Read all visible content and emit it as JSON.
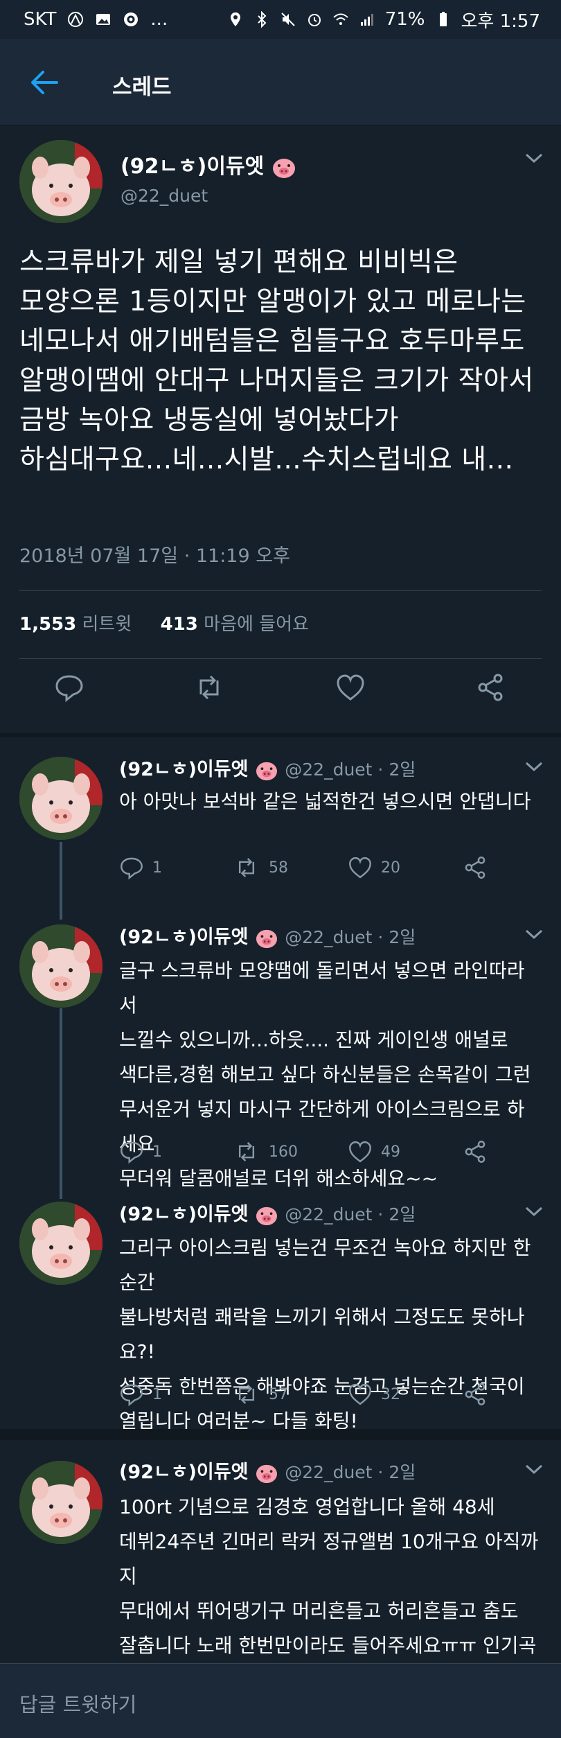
{
  "status_bar": {
    "carrier": "SKT",
    "more": "...",
    "battery": "71%",
    "time": "오후 1:57"
  },
  "header": {
    "title": "스레드"
  },
  "main_tweet": {
    "name": "(92ㄴㅎ)이듀엣",
    "handle": "@22_duet",
    "text": "스크류바가 제일 넣기 편해요 비비빅은\n모양으론 1등이지만 알맹이가 있고 메로나는\n네모나서 애기배텀들은 힘들구요 호두마루도\n알맹이땜에 안대구 나머지들은 크기가 작아서\n금방 녹아요 냉동실에 넣어놨다가\n하심대구요...네...시발...수치스럽네요 내...",
    "date": "2018년 07월 17일 · 11:19 오후",
    "retweets": "1,553",
    "retweets_label": "리트윗",
    "likes": "413",
    "likes_label": "마음에 들어요"
  },
  "replies": [
    {
      "name": "(92ㄴㅎ)이듀엣",
      "handle": "@22_duet · 2일",
      "text": "아 아맛나 보석바 같은 넓적한건 넣으시면 안댑니다",
      "replies": "1",
      "retweets": "58",
      "likes": "20"
    },
    {
      "name": "(92ㄴㅎ)이듀엣",
      "handle": "@22_duet · 2일",
      "text": "글구 스크류바 모양땜에 돌리면서 넣으면 라인따라서\n느낄수 있으니까...하읏.... 진짜 게이인생 애널로\n색다른,경험 해보고 싶다 하신분들은 손목같이 그런\n무서운거 넣지 마시구 간단하게 아이스크림으로 하세요\n무더워 달콤애널로 더위 해소하세요~~",
      "replies": "1",
      "retweets": "160",
      "likes": "49"
    },
    {
      "name": "(92ㄴㅎ)이듀엣",
      "handle": "@22_duet · 2일",
      "text": "그리구 아이스크림 넣는건 무조건 녹아요 하지만 한순간\n불나방처럼 쾌락을 느끼기 위해서 그정도도 못하나요?!\n성중독 한번쯤은 해봐야죠 눈감고 넣는순간 천국이\n열립니다 여러분~ 다들 화팅!",
      "replies": "1",
      "retweets": "57",
      "likes": "32"
    },
    {
      "name": "(92ㄴㅎ)이듀엣",
      "handle": "@22_duet · 2일",
      "text": "100rt 기념으로 김경호 영업합니다 올해 48세\n데뷔24주년 긴머리 락커 정규앨범 10개구요 아직까지\n무대에서 뛰어댕기구 머리흔들고 허리흔들고 춤도\n잘춥니다 노래 한번만이라도 들어주세요ㅠㅠ 인기곡\n나름 많구요ㅠㅠ 노래 짱짱 잘하는 우리 경호형"
    }
  ],
  "composer": {
    "placeholder": "답글 트윗하기"
  }
}
